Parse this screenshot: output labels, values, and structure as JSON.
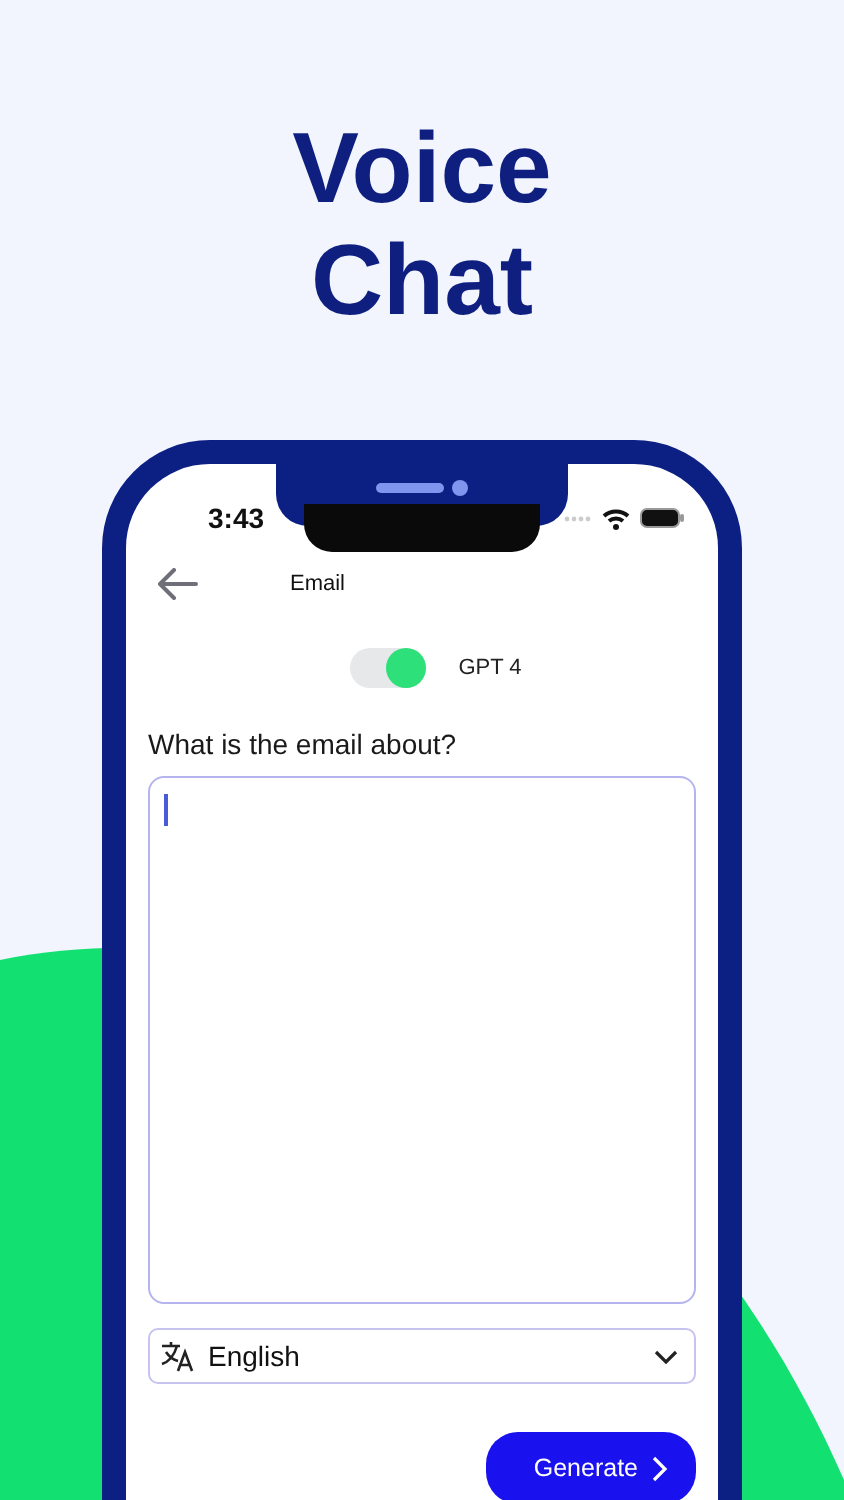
{
  "headline": "Voice Chat",
  "status_bar": {
    "time": "3:43"
  },
  "header": {
    "title": "Email"
  },
  "model_toggle": {
    "label": "GPT 4",
    "on": true
  },
  "prompt": {
    "label": "What is the email about?",
    "focused": true
  },
  "language": {
    "value": "English"
  },
  "generate_button": {
    "label": "Generate"
  }
}
